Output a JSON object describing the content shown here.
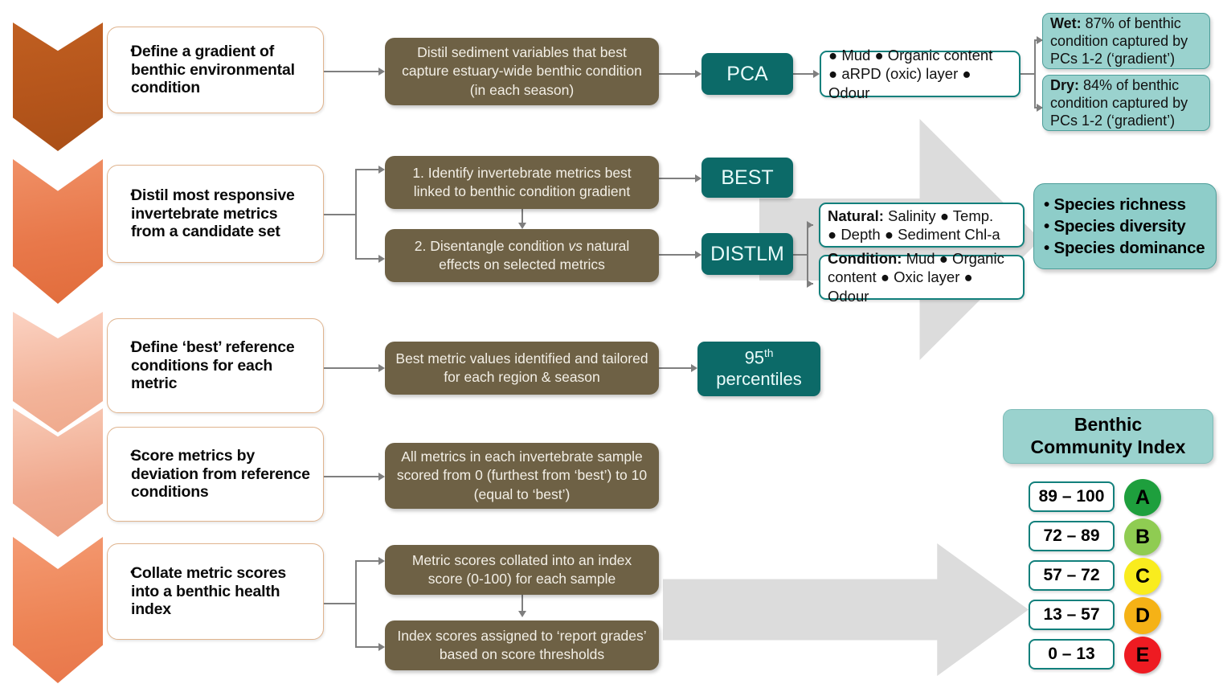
{
  "title": "Benthic health index development flowchart",
  "stages": [
    {
      "id": "stage-1",
      "label": "Define a gradient of benthic environmental condition",
      "chevron_color": "#b5551b"
    },
    {
      "id": "stage-2",
      "label": "Distil most responsive invertebrate metrics from a candidate set",
      "chevron_color": "#e8784a"
    },
    {
      "id": "stage-3",
      "label": "Define ‘best’ reference conditions for each metric",
      "chevron_color": "#f3b49a"
    },
    {
      "id": "stage-4",
      "label": "Score metrics by deviation from reference conditions",
      "chevron_color": "#f0a98e"
    },
    {
      "id": "stage-5",
      "label": "Collate metric scores into a benthic health index",
      "chevron_color": "#ed8354"
    }
  ],
  "process_boxes": [
    {
      "id": "proc-distil-sediment",
      "text": "Distil sediment variables that best capture estuary-wide benthic condition (in each season)"
    },
    {
      "id": "proc-identify-metrics",
      "text": "1. Identify invertebrate metrics best linked to benthic condition gradient"
    },
    {
      "id": "proc-disentangle",
      "text_prefix": "2. Disentangle condition ",
      "text_italic": "vs",
      "text_suffix": " natural effects on selected metrics"
    },
    {
      "id": "proc-best-metric-values",
      "text": "Best metric values identified and tailored for each region & season"
    },
    {
      "id": "proc-all-metrics-scored",
      "text": "All metrics in each invertebrate sample scored from 0 (furthest from ‘best’) to 10 (equal to ‘best’)"
    },
    {
      "id": "proc-metric-scores-collated",
      "text": "Metric scores collated into an index score (0-100) for each sample"
    },
    {
      "id": "proc-index-scores-assigned",
      "text": "Index scores assigned to ‘report grades’ based on score thresholds"
    }
  ],
  "method_boxes": [
    {
      "id": "method-pca",
      "label": "PCA"
    },
    {
      "id": "method-best",
      "label": "BEST"
    },
    {
      "id": "method-distlm",
      "label": "DISTLM"
    },
    {
      "id": "method-percentiles",
      "label_line1_num": "95",
      "label_line1_sup": "th",
      "label_line2": "percentiles"
    }
  ],
  "variable_boxes": [
    {
      "id": "vars-pca-inputs",
      "line1": "● Mud ● Organic content",
      "line2": "● aRPD (oxic) layer ● Odour"
    },
    {
      "id": "vars-natural",
      "bold": "Natural:",
      "line1_rest": " Salinity ● Temp.",
      "line2": "● Depth ● Sediment Chl-a"
    },
    {
      "id": "vars-condition",
      "bold": "Condition:",
      "line1_rest": " Mud ● Organic",
      "line2": "content ● Oxic layer ● Odour"
    }
  ],
  "result_boxes": [
    {
      "id": "result-wet",
      "bold": "Wet:",
      "rest": " 87% of benthic condition captured by PCs 1-2 (‘gradient’)"
    },
    {
      "id": "result-dry",
      "bold": "Dry:",
      "rest": " 84% of benthic condition captured by PCs 1-2 (‘gradient’)"
    }
  ],
  "species_metrics": {
    "id": "selected-metrics",
    "items": [
      "Species richness",
      "Species diversity",
      "Species dominance"
    ]
  },
  "bci": {
    "title_line1": "Benthic",
    "title_line2": "Community Index",
    "grades": [
      {
        "range": "89 – 100",
        "grade": "A",
        "color": "#1e9f3d"
      },
      {
        "range": "72 – 89",
        "grade": "B",
        "color": "#8fcc52"
      },
      {
        "range": "57 – 72",
        "grade": "C",
        "color": "#f9ec1e"
      },
      {
        "range": "13 – 57",
        "grade": "D",
        "color": "#f5b216"
      },
      {
        "range": "0 – 13",
        "grade": "E",
        "color": "#ee1b22"
      }
    ]
  },
  "colors": {
    "teal_dark": "#0c6a68",
    "teal_light": "#9ad2ce",
    "brown": "#6e6145",
    "grey_arrow": "#dcdcdc",
    "connector": "#7f7f7f"
  }
}
